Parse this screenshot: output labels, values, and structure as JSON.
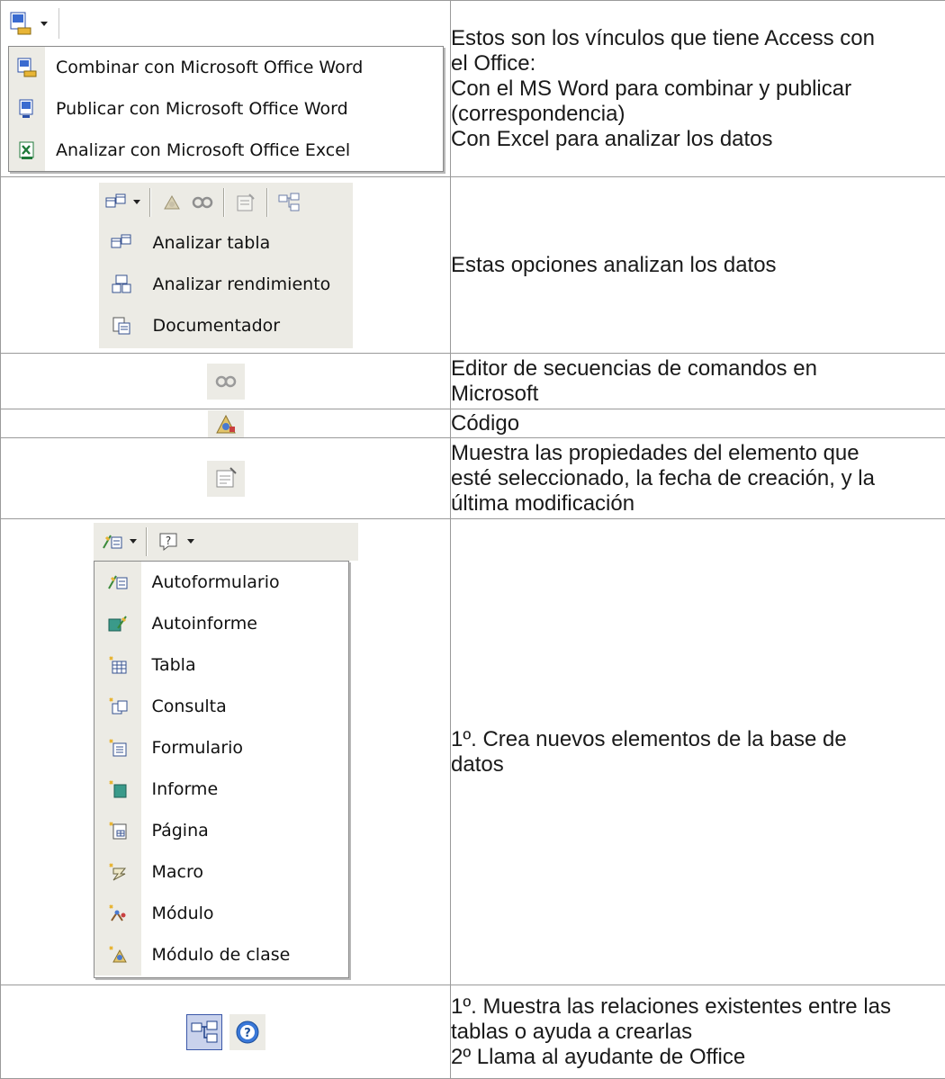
{
  "rows": [
    {
      "menu": {
        "items": [
          {
            "label": "Combinar con Microsoft Office Word",
            "icon": "word-merge-icon"
          },
          {
            "label": "Publicar con Microsoft Office Word",
            "icon": "word-publish-icon"
          },
          {
            "label": "Analizar con Microsoft Office Excel",
            "icon": "excel-icon"
          }
        ]
      },
      "lines": [
        "Estos son los vínculos que tiene Access con",
        "el Office:",
        "Con el MS Word para combinar y publicar",
        "(correspondencia)",
        "Con Excel para analizar los datos"
      ]
    },
    {
      "menu": {
        "items": [
          {
            "label": "Analizar tabla",
            "icon": "analyze-table-icon"
          },
          {
            "label": "Analizar rendimiento",
            "icon": "analyze-performance-icon"
          },
          {
            "label": "Documentador",
            "icon": "documenter-icon"
          }
        ]
      },
      "lines": [
        "Estas opciones analizan los datos"
      ]
    },
    {
      "icon": "script-editor-icon",
      "lines": [
        "Editor de secuencias de comandos en",
        "Microsoft"
      ]
    },
    {
      "icon": "code-icon",
      "lines": [
        "Código"
      ]
    },
    {
      "icon": "properties-icon",
      "lines": [
        "Muestra las propiedades del elemento que",
        "esté seleccionado, la fecha de creación, y la",
        "última modificación"
      ]
    },
    {
      "menu": {
        "items": [
          {
            "label": "Autoformulario",
            "icon": "autoform-icon"
          },
          {
            "label": "Autoinforme",
            "icon": "autoreport-icon"
          },
          {
            "label": "Tabla",
            "icon": "new-table-icon"
          },
          {
            "label": "Consulta",
            "icon": "new-query-icon"
          },
          {
            "label": "Formulario",
            "icon": "new-form-icon"
          },
          {
            "label": "Informe",
            "icon": "new-report-icon"
          },
          {
            "label": "Página",
            "icon": "new-page-icon"
          },
          {
            "label": "Macro",
            "icon": "new-macro-icon"
          },
          {
            "label": "Módulo",
            "icon": "new-module-icon"
          },
          {
            "label": "Módulo de clase",
            "icon": "new-class-module-icon"
          }
        ]
      },
      "lines": [
        "1º. Crea nuevos elementos de la base de",
        "datos"
      ]
    },
    {
      "icons": [
        "relationships-icon",
        "help-icon"
      ],
      "lines": [
        "1º. Muestra las relaciones existentes entre las",
        "tablas o ayuda a crearlas",
        "2º Llama al ayudante de Office"
      ]
    }
  ]
}
